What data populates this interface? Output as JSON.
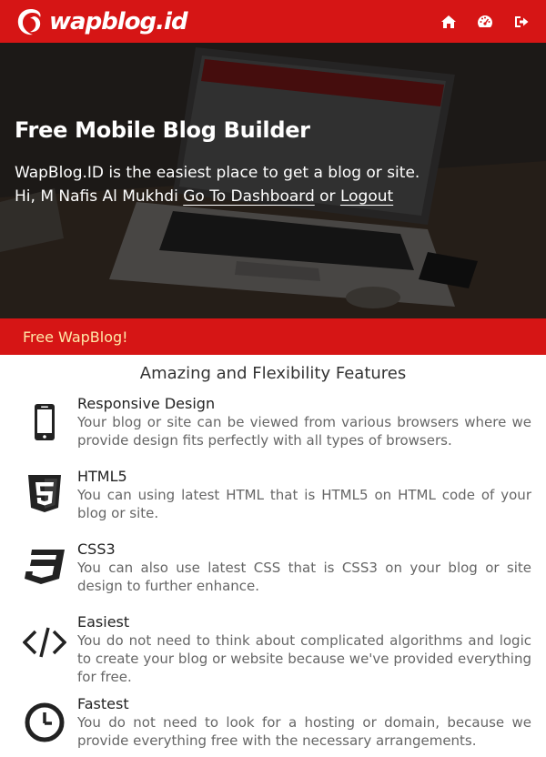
{
  "header": {
    "brand": "wapblog.id",
    "nav": [
      {
        "icon": "home-icon"
      },
      {
        "icon": "dashboard-icon"
      },
      {
        "icon": "logout-icon"
      }
    ],
    "brand_color": "#d61515"
  },
  "hero": {
    "title": "Free Mobile Blog Builder",
    "tagline": "WapBlog.ID is the easiest place to get a blog or site.",
    "greeting": "Hi, M Nafis Al Mukhdi",
    "dashboard_link": "Go To Dashboard",
    "or_text": "or",
    "logout_link": "Logout"
  },
  "banner": {
    "text": "Free WapBlog!",
    "text_color": "#ffe8a8"
  },
  "features": {
    "heading": "Amazing and Flexibility Features",
    "items": [
      {
        "icon": "smartphone-icon",
        "name": "Responsive Design",
        "desc": "Your blog or site can be viewed from various browsers where we provide design fits perfectly with all types of browsers."
      },
      {
        "icon": "html5-icon",
        "name": "HTML5",
        "desc": "You can using latest HTML that is HTML5 on HTML code of your blog or site."
      },
      {
        "icon": "css3-icon",
        "name": "CSS3",
        "desc": "You can also use latest CSS that is CSS3 on your blog or site design to further enhance."
      },
      {
        "icon": "code-icon",
        "name": "Easiest",
        "desc": "You do not need to think about complicated algorithms and logic to create your blog or website because we've provided everything for free."
      },
      {
        "icon": "clock-icon",
        "name": "Fastest",
        "desc": "You do not need to look for a hosting or domain, because we provide everything free with the necessary arrangements."
      }
    ]
  }
}
